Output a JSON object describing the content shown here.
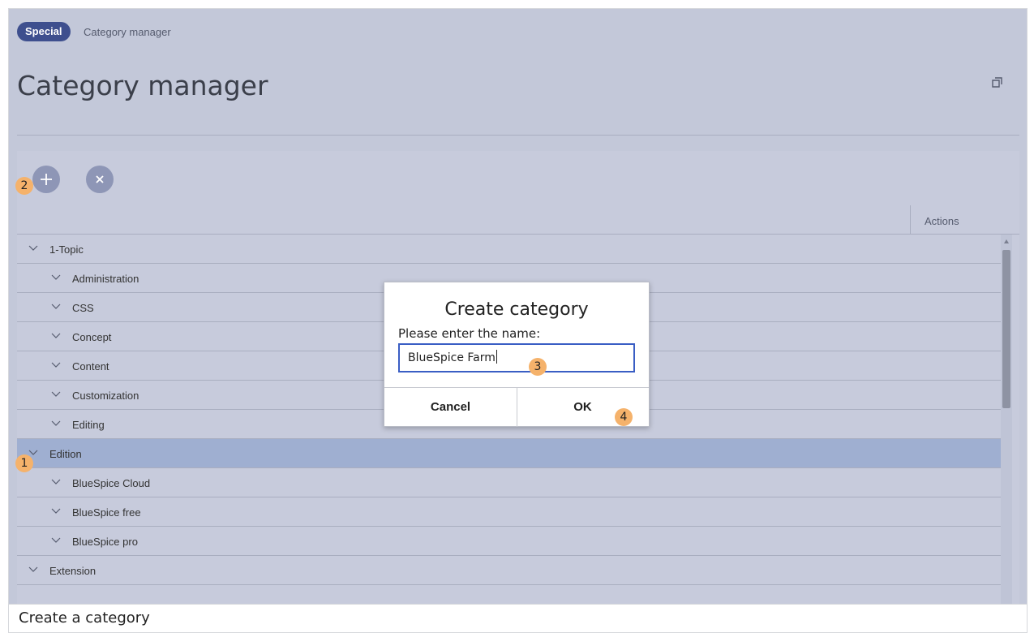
{
  "header": {
    "namespace_badge": "Special",
    "breadcrumb": "Category manager",
    "title": "Category manager",
    "expand_icon": "expand-icon"
  },
  "toolbar": {
    "add_icon": "plus-icon",
    "remove_icon": "close-icon"
  },
  "table": {
    "actions_header": "Actions",
    "rows": [
      {
        "label": "1-Topic",
        "level": 0,
        "selected": false
      },
      {
        "label": "Administration",
        "level": 1,
        "selected": false
      },
      {
        "label": "CSS",
        "level": 1,
        "selected": false
      },
      {
        "label": "Concept",
        "level": 1,
        "selected": false
      },
      {
        "label": "Content",
        "level": 1,
        "selected": false
      },
      {
        "label": "Customization",
        "level": 1,
        "selected": false
      },
      {
        "label": "Editing",
        "level": 1,
        "selected": false
      },
      {
        "label": "Edition",
        "level": 0,
        "selected": true
      },
      {
        "label": "BlueSpice Cloud",
        "level": 1,
        "selected": false
      },
      {
        "label": "BlueSpice free",
        "level": 1,
        "selected": false
      },
      {
        "label": "BlueSpice pro",
        "level": 1,
        "selected": false
      },
      {
        "label": "Extension",
        "level": 0,
        "selected": false
      }
    ]
  },
  "dialog": {
    "title": "Create category",
    "prompt": "Please enter the name:",
    "input_value": "BlueSpice Farm",
    "cancel_label": "Cancel",
    "ok_label": "OK"
  },
  "markers": [
    "1",
    "2",
    "3",
    "4"
  ],
  "caption": "Create a category",
  "colors": {
    "badge": "#3e4f8e",
    "marker": "#f5b26b",
    "selected_row": "#9fafd1",
    "input_border": "#3a5ec4"
  }
}
